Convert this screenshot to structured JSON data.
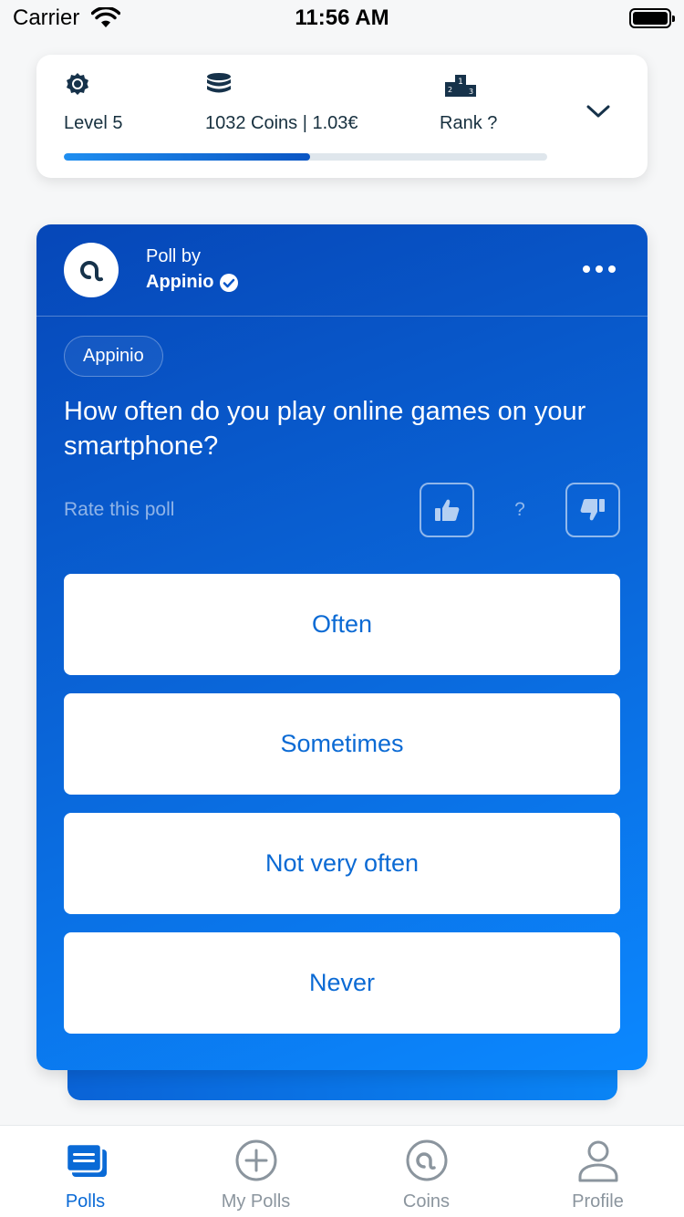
{
  "status_bar": {
    "carrier": "Carrier",
    "time": "11:56 AM"
  },
  "stats": {
    "level": "Level 5",
    "coins": "1032 Coins | 1.03€",
    "rank": "Rank ?",
    "progress_fraction": 0.51
  },
  "poll": {
    "by_label": "Poll by",
    "author": "Appinio",
    "tag": "Appinio",
    "question": "How often do you play online games on your smartphone?",
    "rate_label": "Rate this poll",
    "rate_count": "?",
    "options": [
      "Often",
      "Sometimes",
      "Not very often",
      "Never"
    ]
  },
  "tabs": [
    {
      "label": "Polls",
      "icon": "polls-icon",
      "active": true
    },
    {
      "label": "My Polls",
      "icon": "add-circle-icon",
      "active": false
    },
    {
      "label": "Coins",
      "icon": "coins-at-icon",
      "active": false
    },
    {
      "label": "Profile",
      "icon": "person-icon",
      "active": false
    }
  ],
  "colors": {
    "accent": "#0a6ad6",
    "card_gradient_start": "#0647b8",
    "card_gradient_end": "#0b88ff",
    "inactive_tab": "#8b959e"
  }
}
